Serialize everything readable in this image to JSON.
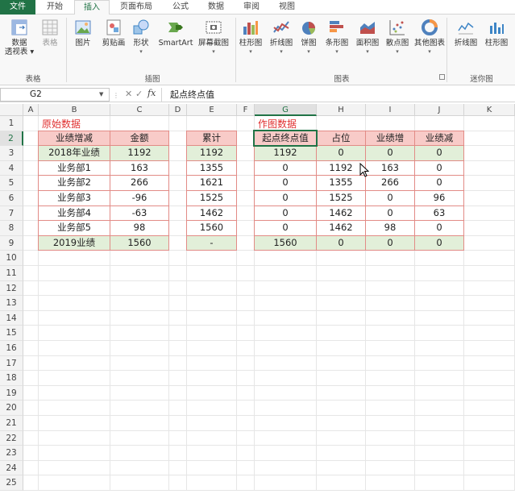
{
  "ribbon_tabs": [
    "文件",
    "开始",
    "插入",
    "页面布局",
    "公式",
    "数据",
    "审阅",
    "视图"
  ],
  "ribbon": {
    "buttons": [
      {
        "line1": "数据",
        "line2": "透视表",
        "dd": true,
        "icon": "pivot-table-icon"
      },
      {
        "line1": "表格",
        "line2": "",
        "dd": false,
        "icon": "table-icon",
        "disabled": true
      },
      {
        "line1": "图片",
        "line2": "",
        "dd": false,
        "icon": "picture-icon"
      },
      {
        "line1": "剪贴画",
        "line2": "",
        "dd": false,
        "icon": "clipart-icon"
      },
      {
        "line1": "形状",
        "line2": "",
        "dd": true,
        "icon": "shapes-icon"
      },
      {
        "line1": "SmartArt",
        "line2": "",
        "dd": false,
        "icon": "smartart-icon"
      },
      {
        "line1": "屏幕截图",
        "line2": "",
        "dd": true,
        "icon": "screenshot-icon"
      },
      {
        "line1": "柱形图",
        "line2": "",
        "dd": true,
        "icon": "column-chart-icon"
      },
      {
        "line1": "折线图",
        "line2": "",
        "dd": true,
        "icon": "line-chart-icon"
      },
      {
        "line1": "饼图",
        "line2": "",
        "dd": true,
        "icon": "pie-chart-icon"
      },
      {
        "line1": "条形图",
        "line2": "",
        "dd": true,
        "icon": "bar-chart-icon"
      },
      {
        "line1": "面积图",
        "line2": "",
        "dd": true,
        "icon": "area-chart-icon"
      },
      {
        "line1": "散点图",
        "line2": "",
        "dd": true,
        "icon": "scatter-chart-icon"
      },
      {
        "line1": "其他图表",
        "line2": "",
        "dd": true,
        "icon": "other-charts-icon"
      },
      {
        "line1": "折线图",
        "line2": "",
        "dd": false,
        "icon": "sparkline-line-icon"
      },
      {
        "line1": "柱形图",
        "line2": "",
        "dd": false,
        "icon": "sparkline-column-icon"
      }
    ],
    "groups": [
      "表格",
      "插图",
      "图表",
      "迷你图"
    ]
  },
  "formula_bar": {
    "name_box": "G2",
    "fx": "fx",
    "content": "起点终点值"
  },
  "columns": [
    "A",
    "B",
    "C",
    "D",
    "E",
    "F",
    "G",
    "H",
    "I",
    "J",
    "K"
  ],
  "rows": [
    "1",
    "2",
    "3",
    "4",
    "5",
    "6",
    "7",
    "8",
    "9",
    "10",
    "11",
    "12",
    "13",
    "14",
    "15",
    "16",
    "17",
    "18",
    "19",
    "20",
    "21",
    "22",
    "23",
    "24",
    "25"
  ],
  "titles": {
    "original": "原始数据",
    "chart": "作图数据"
  },
  "table1": {
    "header": [
      "业绩增减",
      "金额"
    ],
    "rows": [
      [
        "2018年业绩",
        "1192"
      ],
      [
        "业务部1",
        "163"
      ],
      [
        "业务部2",
        "266"
      ],
      [
        "业务部3",
        "-96"
      ],
      [
        "业务部4",
        "-63"
      ],
      [
        "业务部5",
        "98"
      ],
      [
        "2019业绩",
        "1560"
      ]
    ]
  },
  "table2": {
    "header": "累计",
    "rows": [
      "1192",
      "1355",
      "1621",
      "1525",
      "1462",
      "1560",
      "-"
    ]
  },
  "table3": {
    "header": [
      "起点终点值",
      "占位",
      "业绩增",
      "业绩减"
    ],
    "rows": [
      [
        "1192",
        "0",
        "0",
        "0"
      ],
      [
        "0",
        "1192",
        "163",
        "0"
      ],
      [
        "0",
        "1355",
        "266",
        "0"
      ],
      [
        "0",
        "1525",
        "0",
        "96"
      ],
      [
        "0",
        "1462",
        "0",
        "63"
      ],
      [
        "0",
        "1462",
        "98",
        "0"
      ],
      [
        "1560",
        "0",
        "0",
        "0"
      ]
    ]
  },
  "colors": {
    "accent": "#217346",
    "header_fill": "#f8cbc8",
    "total_fill": "#e2efd9",
    "title_red": "#e03030"
  }
}
